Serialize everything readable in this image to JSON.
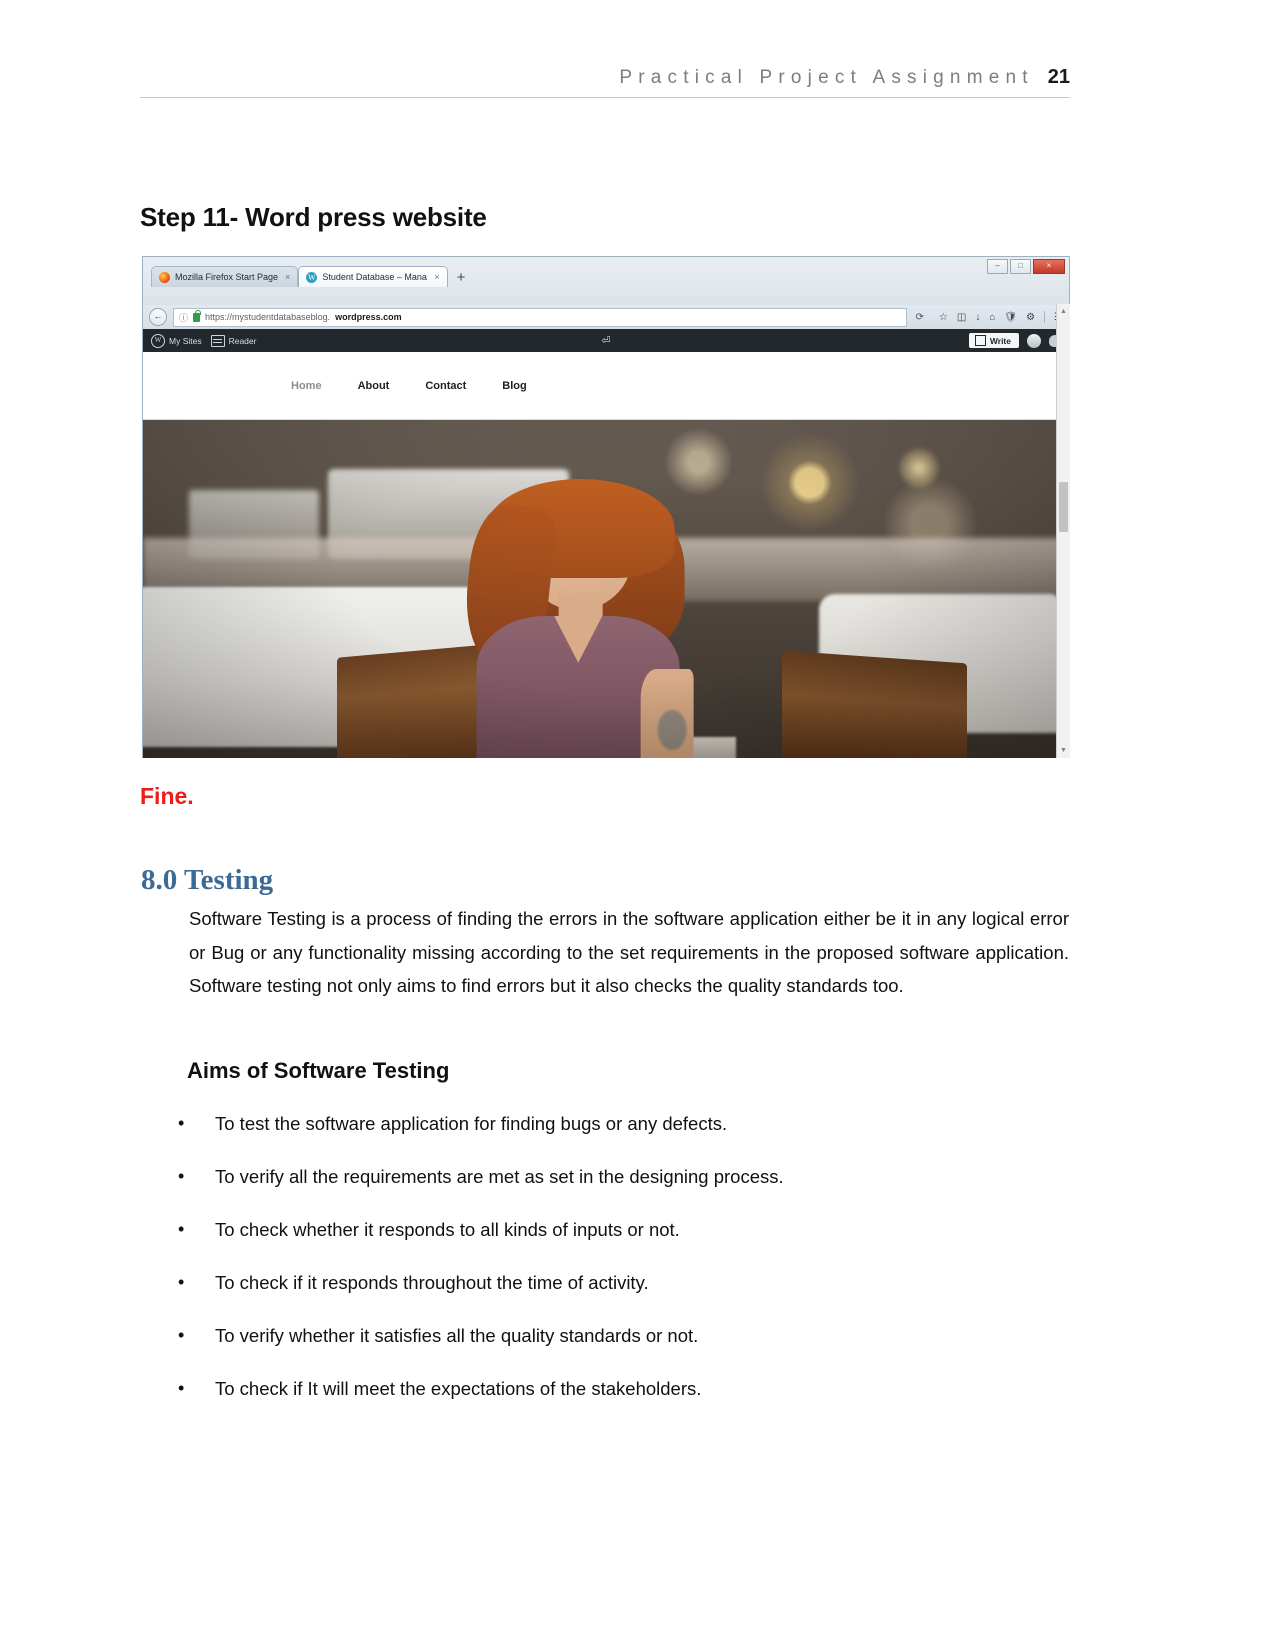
{
  "header": {
    "title": "Practical Project Assignment",
    "page_number": "21"
  },
  "step_heading": "Step 11- Word press website",
  "browser": {
    "window_controls": {
      "minimize": "–",
      "maximize": "□",
      "close": "×"
    },
    "tabs": [
      {
        "label": "Mozilla Firefox Start Page",
        "favicon": "firefox-icon",
        "close": "×",
        "active": false
      },
      {
        "label": "Student Database – Manage",
        "favicon": "wordpress-icon",
        "close": "×",
        "active": true
      }
    ],
    "new_tab_label": "+",
    "nav": {
      "back": "←",
      "info": "ⓘ",
      "lock": "lock-icon",
      "url_prefix": "https://mystudentdatabaseblog.",
      "url_domain": "wordpress.com",
      "reload": "⟳"
    },
    "toolbar_icons": [
      "star-icon",
      "reader-icon",
      "download-icon",
      "home-icon",
      "shield-icon",
      "sync-icon",
      "menu-icon"
    ],
    "scrollbar": {
      "up": "▲",
      "down": "▼"
    }
  },
  "wordpress": {
    "adminbar": {
      "my_sites": "My Sites",
      "reader": "Reader",
      "center_icon": "⏎",
      "write_label": "Write",
      "avatar": "user-avatar",
      "notifications": "bell-icon"
    },
    "site_nav": [
      {
        "label": "Home",
        "current": true
      },
      {
        "label": "About",
        "current": false
      },
      {
        "label": "Contact",
        "current": false
      },
      {
        "label": "Blog",
        "current": false
      }
    ]
  },
  "fine_text": "Fine.",
  "testing": {
    "heading": "8.0 Testing",
    "paragraph": "Software Testing is a process of finding the errors in the software application either be it in any logical error or Bug or any functionality missing according to the set requirements in the proposed software application. Software testing not only aims to find errors but it also checks the quality standards too.",
    "aims_heading": "Aims of Software Testing",
    "aims": [
      "To test the software application for finding bugs or any defects.",
      "To verify all the requirements are met as set in the designing process.",
      "To check whether it responds to all kinds of inputs or not.",
      "To check if it responds throughout the time of activity.",
      "To verify whether it satisfies all the quality standards or not.",
      "To check if It will meet the expectations of the stakeholders."
    ]
  },
  "colors": {
    "heading_blue": "#3b6a95",
    "fine_red": "#ee1b16",
    "header_gray": "#7d7d7d",
    "adminbar_dark": "#23282d"
  }
}
